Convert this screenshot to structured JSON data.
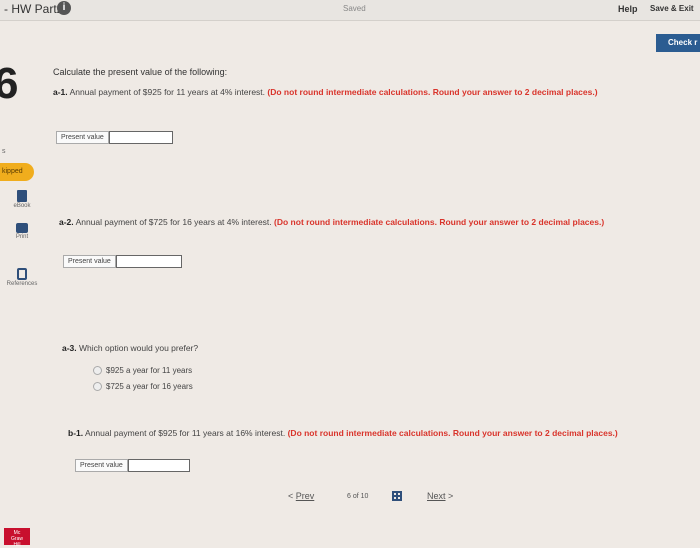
{
  "header": {
    "title": "- HW Part2",
    "info_icon": "info-icon",
    "saved": "Saved",
    "help": "Help",
    "save_exit": "Save & Exit",
    "check": "Check r"
  },
  "rail": {
    "question_number": "6",
    "s_label": "s",
    "skipped": "kipped",
    "ebook": "eBook",
    "print": "Print",
    "references": "References",
    "logo": "Mc\nGraw\nHill"
  },
  "question": {
    "intro": "Calculate the present value of the following:",
    "a1_label": "a-1.",
    "a1_text": "Annual payment of $925 for 11 years at 4% interest.",
    "a2_label": "a-2.",
    "a2_text": "Annual payment of $725 for 16 years at 4% interest.",
    "a3_label": "a-3.",
    "a3_text": "Which option would you prefer?",
    "b1_label": "b-1.",
    "b1_text": "Annual payment of $925 for 11 years at 16% interest.",
    "warning": "(Do not round intermediate calculations. Round your answer to 2 decimal places.)",
    "present_value_label": "Present value",
    "options": [
      "$925 a year for 11 years",
      "$725 a year for 16 years"
    ]
  },
  "footer": {
    "prev": "Prev",
    "page_current": "6",
    "page_of": "of",
    "page_total": "10",
    "next": "Next"
  }
}
